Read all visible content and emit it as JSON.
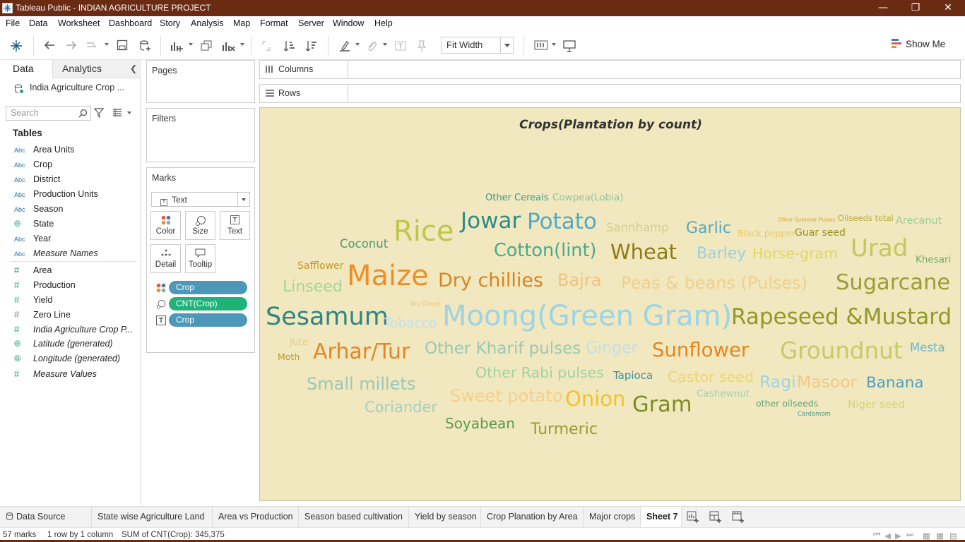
{
  "window": {
    "title": "Tableau Public - INDIAN AGRICULTURE PROJECT"
  },
  "menu": [
    "File",
    "Data",
    "Worksheet",
    "Dashboard",
    "Story",
    "Analysis",
    "Map",
    "Format",
    "Server",
    "Window",
    "Help"
  ],
  "toolbar": {
    "fit": "Fit Width",
    "show_me": "Show Me"
  },
  "datapane": {
    "tab_data": "Data",
    "tab_analytics": "Analytics",
    "source": "India Agriculture Crop ...",
    "search_placeholder": "Search",
    "tables_heading": "Tables",
    "fields": [
      {
        "type": "Abc",
        "name": "Area Units"
      },
      {
        "type": "Abc",
        "name": "Crop"
      },
      {
        "type": "Abc",
        "name": "District"
      },
      {
        "type": "Abc",
        "name": "Production Units"
      },
      {
        "type": "Abc",
        "name": "Season"
      },
      {
        "type": "geo",
        "name": "State"
      },
      {
        "type": "Abc",
        "name": "Year"
      },
      {
        "type": "Abc",
        "name": "Measure Names"
      },
      {
        "type": "#",
        "name": "Area"
      },
      {
        "type": "#",
        "name": "Production"
      },
      {
        "type": "#",
        "name": "Yield"
      },
      {
        "type": "#",
        "name": "Zero Line"
      },
      {
        "type": "#",
        "name": "India Agriculture Crop P..."
      },
      {
        "type": "geo",
        "name": "Latitude (generated)"
      },
      {
        "type": "geo",
        "name": "Longitude (generated)"
      },
      {
        "type": "#",
        "name": "Measure Values"
      }
    ]
  },
  "cards": {
    "pages": "Pages",
    "filters": "Filters",
    "marks": "Marks",
    "mark_type": "Text",
    "buttons": [
      "Color",
      "Size",
      "Text",
      "Detail",
      "Tooltip"
    ],
    "pills": [
      {
        "label": "Crop",
        "color": "#4d98b8"
      },
      {
        "label": "CNT(Crop)",
        "color": "#1fb37a"
      },
      {
        "label": "Crop",
        "color": "#4d98b8"
      }
    ]
  },
  "shelves": {
    "columns": "Columns",
    "rows": "Rows"
  },
  "viz": {
    "title": "Crops(Plantation by count)",
    "background": "#f1e8bf",
    "words": [
      {
        "text": "Other Cereals",
        "color": "#3a9a88"
      },
      {
        "text": "Cowpea(Lobia)",
        "color": "#8cc79b"
      },
      {
        "text": "Rice",
        "color": "#bcc74a"
      },
      {
        "text": "Jowar",
        "color": "#2e8a86"
      },
      {
        "text": "Potato",
        "color": "#4fa9c8"
      },
      {
        "text": "Sannhamp",
        "color": "#d6d08a"
      },
      {
        "text": "Garlic",
        "color": "#5ba7bf"
      },
      {
        "text": "Other Summer Pulses",
        "color": "#d9a43a"
      },
      {
        "text": "Oilseeds total",
        "color": "#b9ab3a"
      },
      {
        "text": "Arecanut",
        "color": "#9fcc9a"
      },
      {
        "text": "Black pepper",
        "color": "#eec95f"
      },
      {
        "text": "Guar seed",
        "color": "#9a8f2a"
      },
      {
        "text": "Coconut",
        "color": "#4d9a78"
      },
      {
        "text": "Cotton(lint)",
        "color": "#4ba88a"
      },
      {
        "text": "Wheat",
        "color": "#8e7b16"
      },
      {
        "text": "Barley",
        "color": "#9dcfe0"
      },
      {
        "text": "Horse-gram",
        "color": "#e2d764"
      },
      {
        "text": "Urad",
        "color": "#c2c85a"
      },
      {
        "text": "Khesari",
        "color": "#6aa96a"
      },
      {
        "text": "Safflower",
        "color": "#c4962d"
      },
      {
        "text": "Maize",
        "color": "#ef8e29"
      },
      {
        "text": "Dry chillies",
        "color": "#d7831f"
      },
      {
        "text": "Bajra",
        "color": "#f1c27f"
      },
      {
        "text": "Peas & beans (Pulses)",
        "color": "#f1cf8c"
      },
      {
        "text": "Sugarcane",
        "color": "#9a9d38"
      },
      {
        "text": "Linseed",
        "color": "#a8d39a"
      },
      {
        "text": "Dry Ginger",
        "color": "#f0c074"
      },
      {
        "text": "Sesamum",
        "color": "#2f8682"
      },
      {
        "text": "Tobacco",
        "color": "#bfe2ea"
      },
      {
        "text": "Moong(Green Gram)",
        "color": "#9dd3e4"
      },
      {
        "text": "Rapeseed &Mustard",
        "color": "#8e9a2a"
      },
      {
        "text": "Jute",
        "color": "#e0d07c"
      },
      {
        "text": "Moth",
        "color": "#b8952f"
      },
      {
        "text": "Arhar/Tur",
        "color": "#e38626"
      },
      {
        "text": "Other Kharif pulses",
        "color": "#9bc7b4"
      },
      {
        "text": "Ginger",
        "color": "#bde0ec"
      },
      {
        "text": "Sunflower",
        "color": "#e5861f"
      },
      {
        "text": "Groundnut",
        "color": "#c6cb6a"
      },
      {
        "text": "Mesta",
        "color": "#68b6d0"
      },
      {
        "text": "Other Rabi pulses",
        "color": "#9fd3a2"
      },
      {
        "text": "Tapioca",
        "color": "#3d8ea4"
      },
      {
        "text": "Castor seed",
        "color": "#f0d36c"
      },
      {
        "text": "Small millets",
        "color": "#9bc7b4"
      },
      {
        "text": "Cashewnut",
        "color": "#9fcfb3"
      },
      {
        "text": "Ragi",
        "color": "#9fd3e5"
      },
      {
        "text": "Masoor",
        "color": "#f1c888"
      },
      {
        "text": "Banana",
        "color": "#4f9fc0"
      },
      {
        "text": "Sweet potato",
        "color": "#f4cf8f"
      },
      {
        "text": "Onion",
        "color": "#f2c22e"
      },
      {
        "text": "Gram",
        "color": "#7e8d22"
      },
      {
        "text": "other oilseeds",
        "color": "#5ca278"
      },
      {
        "text": "Niger seed",
        "color": "#d2d77f"
      },
      {
        "text": "Cardamom",
        "color": "#4f9a8a"
      },
      {
        "text": "Coriander",
        "color": "#a3cfc1"
      },
      {
        "text": "Soyabean",
        "color": "#5a9a49"
      },
      {
        "text": "Turmeric",
        "color": "#9a9d33"
      }
    ]
  },
  "sheet_tabs": [
    "Data Source",
    "State wise Agriculture Land",
    "Area vs Production",
    "Season based cultivation",
    "Yield by season",
    "Crop Planation by Area",
    "Major crops",
    "Sheet 7"
  ],
  "status": {
    "marks": "57 marks",
    "dims": "1 row by 1 column",
    "sum": "SUM of CNT(Crop): 345,375"
  }
}
